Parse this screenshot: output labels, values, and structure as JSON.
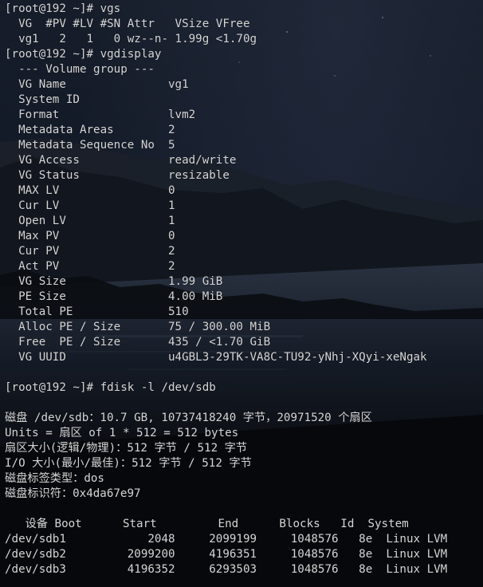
{
  "terminal": {
    "lines": [
      "[root@192 ~]# vgs",
      "  VG  #PV #LV #SN Attr   VSize VFree",
      "  vg1   2   1   0 wz--n- 1.99g <1.70g",
      "[root@192 ~]# vgdisplay",
      "  --- Volume group ---",
      "  VG Name               vg1",
      "  System ID",
      "  Format                lvm2",
      "  Metadata Areas        2",
      "  Metadata Sequence No  5",
      "  VG Access             read/write",
      "  VG Status             resizable",
      "  MAX LV                0",
      "  Cur LV                1",
      "  Open LV               1",
      "  Max PV                0",
      "  Cur PV                2",
      "  Act PV                2",
      "  VG Size               1.99 GiB",
      "  PE Size               4.00 MiB",
      "  Total PE              510",
      "  Alloc PE / Size       75 / 300.00 MiB",
      "  Free  PE / Size       435 / <1.70 GiB",
      "  VG UUID               u4GBL3-29TK-VA8C-TU92-yNhj-XQyi-xeNgak",
      "",
      "[root@192 ~]# fdisk -l /dev/sdb",
      "",
      "磁盘 /dev/sdb：10.7 GB, 10737418240 字节，20971520 个扇区",
      "Units = 扇区 of 1 * 512 = 512 bytes",
      "扇区大小(逻辑/物理)：512 字节 / 512 字节",
      "I/O 大小(最小/最佳)：512 字节 / 512 字节",
      "磁盘标签类型：dos",
      "磁盘标识符：0x4da67e97",
      "",
      "   设备 Boot      Start         End      Blocks   Id  System",
      "/dev/sdb1            2048     2099199     1048576   8e  Linux LVM",
      "/dev/sdb2         2099200     4196351     1048576   8e  Linux LVM",
      "/dev/sdb3         4196352     6293503     1048576   8e  Linux LVM"
    ]
  },
  "theme": {
    "text_color": "#d6d6d6",
    "background": "#0b0f17"
  }
}
